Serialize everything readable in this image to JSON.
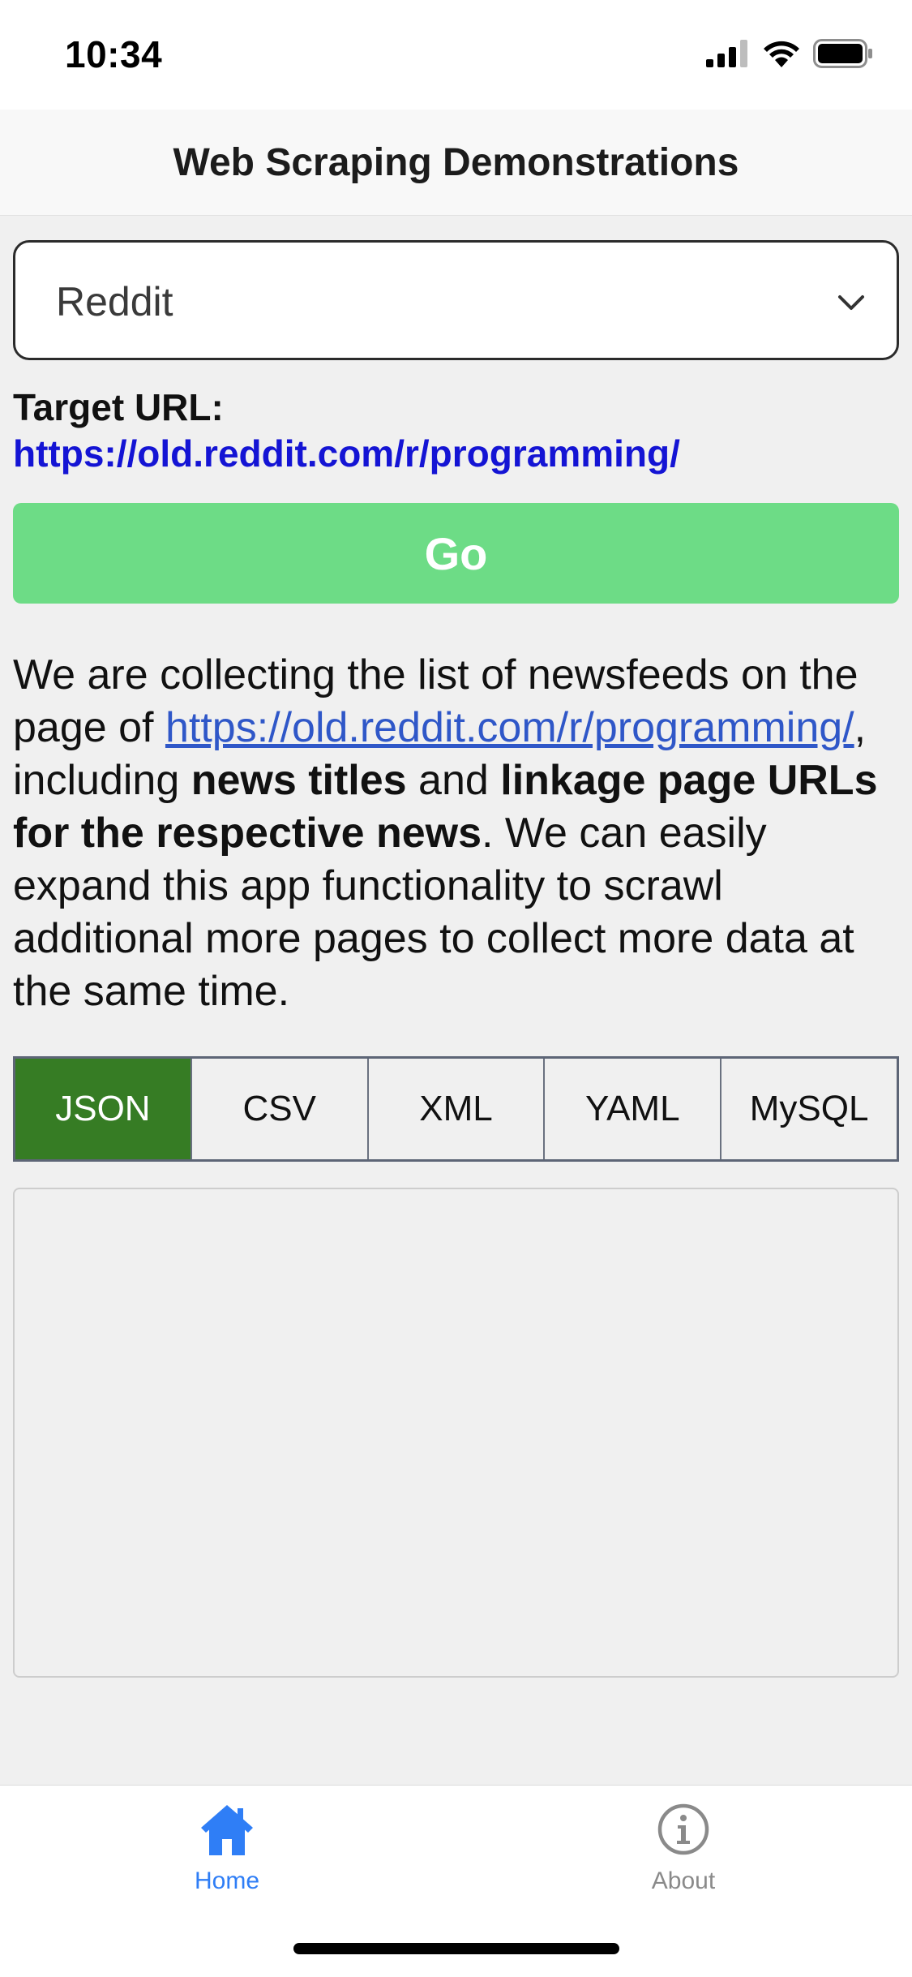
{
  "status_bar": {
    "time": "10:34"
  },
  "header": {
    "title": "Web Scraping Demonstrations"
  },
  "site_select": {
    "selected": "Reddit"
  },
  "target": {
    "label": "Target URL:",
    "url": "https://old.reddit.com/r/programming/"
  },
  "go_button": {
    "label": "Go",
    "color": "#6ddc86"
  },
  "description": {
    "part1": "We are collecting the list of newsfeeds on the page of ",
    "link": "https://old.reddit.com/r/programming/",
    "part2": ", including ",
    "bold1": "news titles",
    "part3": " and ",
    "bold2": "linkage page URLs for the respective news",
    "part4": ". We can easily expand this app functionality to scrawl additional more pages to collect more data at the same time."
  },
  "format_tabs": {
    "items": [
      "JSON",
      "CSV",
      "XML",
      "YAML",
      "MySQL"
    ],
    "active": "JSON",
    "active_color": "#367c24"
  },
  "output": {
    "text": ""
  },
  "tab_bar": {
    "items": [
      {
        "label": "Home",
        "icon": "home-icon",
        "active": true
      },
      {
        "label": "About",
        "icon": "info-icon",
        "active": false
      }
    ],
    "active_color": "#2f7ef6",
    "inactive_color": "#8a8a8a"
  }
}
